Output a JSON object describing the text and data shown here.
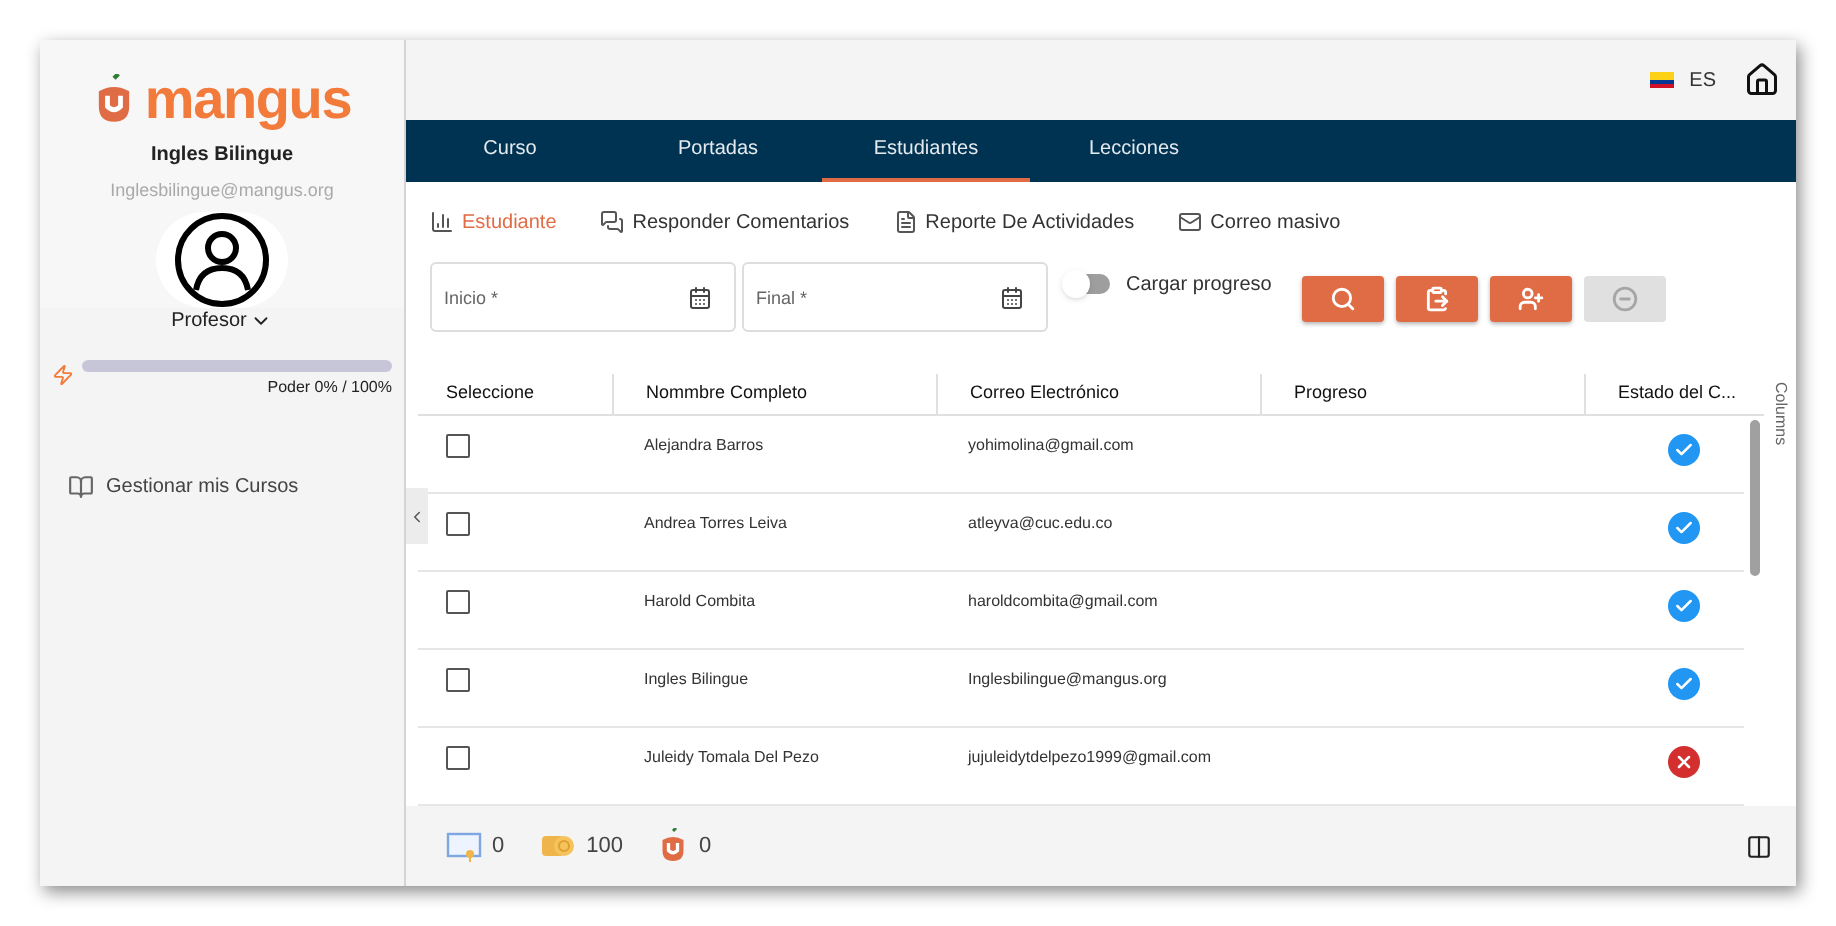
{
  "sidebar": {
    "logo": "mangus",
    "user_name": "Ingles Bilingue",
    "user_email": "Inglesbilingue@mangus.org",
    "role": "Profesor",
    "power": {
      "level": 0,
      "reading": "Poder 0% / 100%"
    },
    "menu": [
      {
        "label": "Gestionar mis Cursos"
      }
    ]
  },
  "topbar": {
    "language": "ES"
  },
  "tabs": [
    {
      "label": "Curso",
      "selected": false
    },
    {
      "label": "Portadas",
      "selected": false
    },
    {
      "label": "Estudiantes",
      "selected": true
    },
    {
      "label": "Lecciones",
      "selected": false
    }
  ],
  "subtabs": [
    {
      "label": "Estudiante",
      "selected": true
    },
    {
      "label": "Responder Comentarios",
      "selected": false
    },
    {
      "label": "Reporte De Actividades",
      "selected": false
    },
    {
      "label": "Correo masivo",
      "selected": false
    }
  ],
  "filters": {
    "start": {
      "placeholder": "Inicio *"
    },
    "end": {
      "placeholder": "Final *"
    },
    "load_progress": {
      "label": "Cargar progreso",
      "on": false
    }
  },
  "actions": [
    {
      "kind": "search",
      "disabled": false
    },
    {
      "kind": "download",
      "disabled": false
    },
    {
      "kind": "add-user",
      "disabled": false
    },
    {
      "kind": "remove",
      "disabled": true
    }
  ],
  "table": {
    "columns": [
      "Seleccione",
      "Nommbre Completo",
      "Correo Electrónico",
      "Progreso",
      "Estado del C..."
    ],
    "columns_toggle": "Columns",
    "rows": [
      {
        "checked": false,
        "name": "Alejandra Barros",
        "email": "yohimolina@gmail.com",
        "approved": true
      },
      {
        "checked": false,
        "name": "Andrea Torres Leiva",
        "email": "atleyva@cuc.edu.co",
        "approved": true
      },
      {
        "checked": false,
        "name": "Harold Combita",
        "email": "haroldcombita@gmail.com",
        "approved": true
      },
      {
        "checked": false,
        "name": "Ingles Bilingue",
        "email": "Inglesbilingue@mangus.org",
        "approved": true
      },
      {
        "checked": false,
        "name": "Juleidy Tomala Del Pezo",
        "email": "jujuleidytdelpezo1999@gmail.com",
        "approved": false
      }
    ]
  },
  "footer": [
    {
      "kind": "certificate",
      "count": "0"
    },
    {
      "kind": "coins",
      "count": "100"
    },
    {
      "kind": "mangus",
      "count": "0"
    }
  ]
}
